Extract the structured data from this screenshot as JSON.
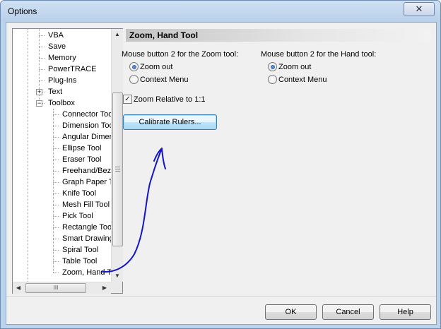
{
  "window": {
    "title": "Options",
    "close_glyph": "✕"
  },
  "tree": {
    "items": [
      {
        "label": "VBA",
        "level": 1
      },
      {
        "label": "Save",
        "level": 1
      },
      {
        "label": "Memory",
        "level": 1
      },
      {
        "label": "PowerTRACE",
        "level": 1
      },
      {
        "label": "Plug-Ins",
        "level": 1
      },
      {
        "label": "Text",
        "level": 1,
        "expander": "+"
      },
      {
        "label": "Toolbox",
        "level": 1,
        "expander": "−"
      },
      {
        "label": "Connector Too",
        "level": 2
      },
      {
        "label": "Dimension Too",
        "level": 2
      },
      {
        "label": "Angular Dimer",
        "level": 2
      },
      {
        "label": "Ellipse Tool",
        "level": 2
      },
      {
        "label": "Eraser Tool",
        "level": 2
      },
      {
        "label": "Freehand/Bez",
        "level": 2
      },
      {
        "label": "Graph Paper T",
        "level": 2
      },
      {
        "label": "Knife Tool",
        "level": 2
      },
      {
        "label": "Mesh Fill Tool",
        "level": 2
      },
      {
        "label": "Pick Tool",
        "level": 2
      },
      {
        "label": "Rectangle Too",
        "level": 2
      },
      {
        "label": "Smart Drawing",
        "level": 2
      },
      {
        "label": "Spiral Tool",
        "level": 2
      },
      {
        "label": "Table Tool",
        "level": 2
      },
      {
        "label": "Zoom, Hand T",
        "level": 2
      }
    ],
    "hscroll_grip": "III"
  },
  "panel": {
    "title": "Zoom, Hand Tool",
    "zoom_group": {
      "label": "Mouse button 2 for the Zoom tool:",
      "options": [
        "Zoom out",
        "Context Menu"
      ],
      "selected": "Zoom out"
    },
    "hand_group": {
      "label": "Mouse button 2 for the Hand tool:",
      "options": [
        "Zoom out",
        "Context Menu"
      ],
      "selected": "Zoom out"
    },
    "zoom_relative": {
      "label": "Zoom Relative to 1:1",
      "checked": true,
      "check_glyph": "✓"
    },
    "calibrate_button": "Calibrate Rulers..."
  },
  "footer": {
    "ok": "OK",
    "cancel": "Cancel",
    "help": "Help"
  },
  "colors": {
    "annotation_ink": "#1414c8"
  }
}
